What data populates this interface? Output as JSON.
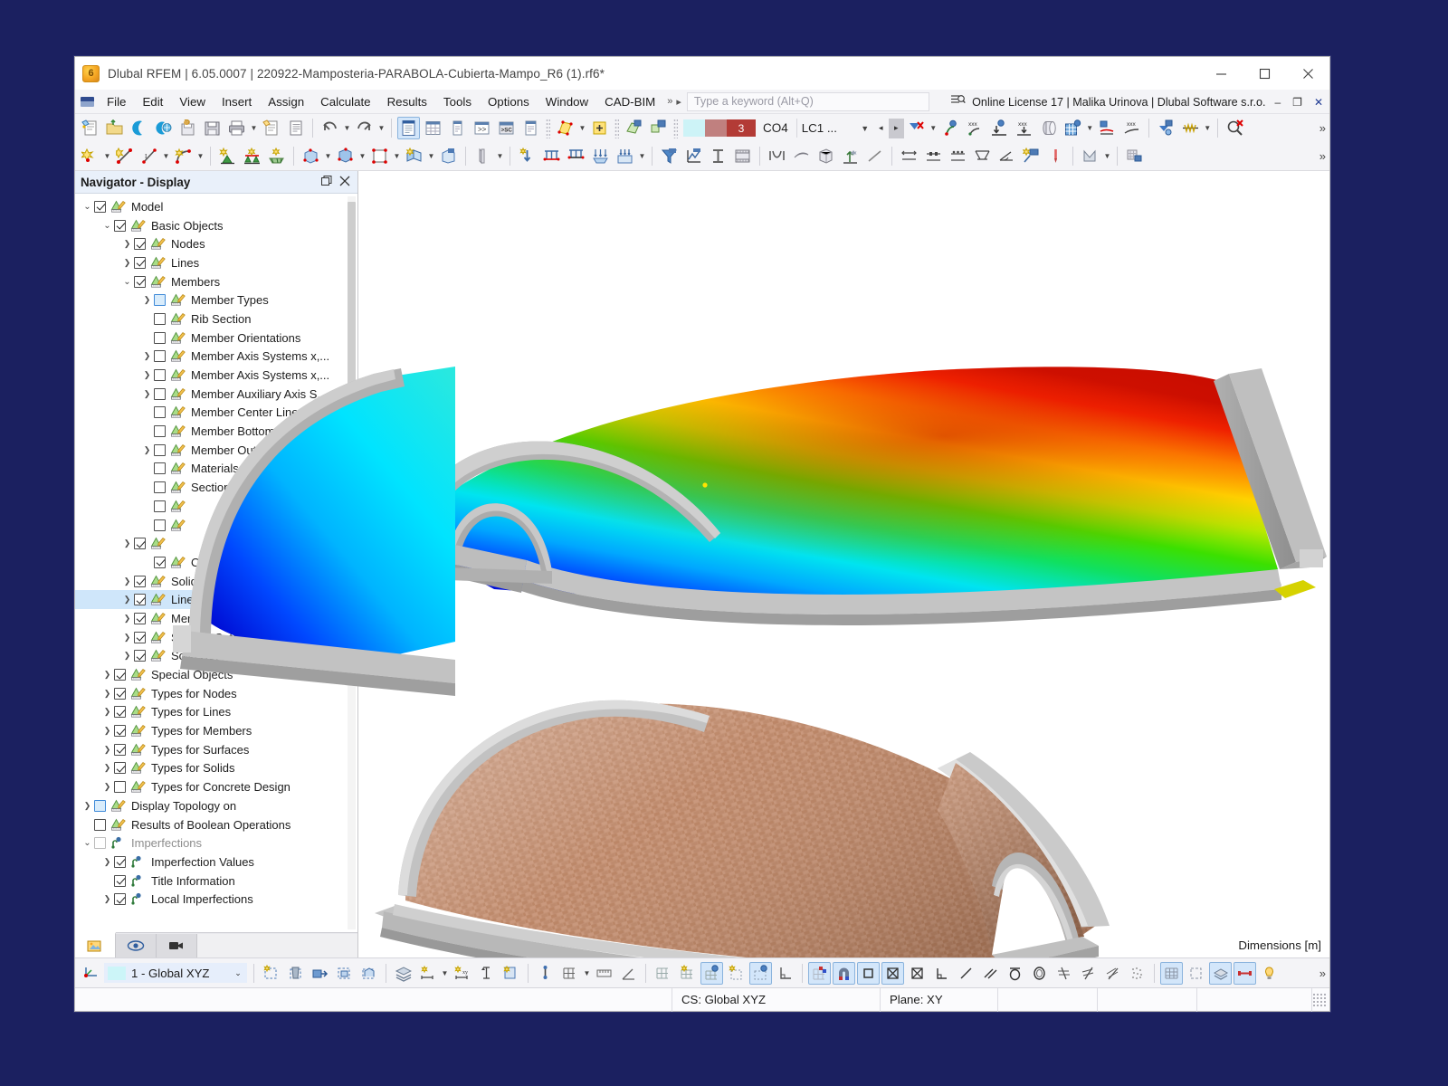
{
  "window": {
    "title": "Dlubal RFEM | 6.05.0007 | 220922-Mamposteria-PARABOLA-Cubierta-Mampo_R6 (1).rf6*",
    "app_icon": "6",
    "minimize": "minimize-icon",
    "maximize": "maximize-icon",
    "close": "close-icon"
  },
  "menu": {
    "items": [
      {
        "label": "File"
      },
      {
        "label": "Edit"
      },
      {
        "label": "View"
      },
      {
        "label": "Insert"
      },
      {
        "label": "Assign"
      },
      {
        "label": "Calculate"
      },
      {
        "label": "Results"
      },
      {
        "label": "Tools"
      },
      {
        "label": "Options"
      },
      {
        "label": "Window"
      },
      {
        "label": "CAD-BIM"
      }
    ],
    "overflow": "»",
    "play": "▸",
    "search_placeholder": "Type a keyword (Alt+Q)",
    "license": "Online License 17 | Malika Urinova | Dlubal Software s.r.o.",
    "license_minimize": "–",
    "license_restore": "❐",
    "license_close": "✕"
  },
  "toolbar": {
    "load_case": {
      "number": "3",
      "combination": "CO4",
      "load_case_label": "LC1 ...",
      "prev": "◂",
      "next": "▸"
    },
    "overflow": "»",
    "row1_icons": [
      "new-model-icon",
      "open-folder-icon",
      "connect-icon",
      "cloud-model-icon",
      "save-as-icon",
      "save-icon",
      "print-icon",
      "export-report-icon",
      "report-icon",
      "undo-icon",
      "redo-icon",
      "navigator-panel-icon",
      "table-panel-icon",
      "list-panel-icon",
      "console-icon",
      "script-icon",
      "data-panel-icon",
      "render-surface-icon",
      "add-object-icon",
      "select-visible-icon",
      "select-all-icon",
      "result-color-icon",
      "deformation-icon",
      "filter-results-icon",
      "node-result-icon",
      "value-xxx-icon",
      "support-reaction-icon",
      "support-values-icon",
      "section-view-icon",
      "grid-results-icon",
      "diagram-result-icon",
      "member-values-icon",
      "result-beam-icon",
      "result-diagram-icon",
      "search-cancel-icon"
    ],
    "row2_icons": [
      "node-icon",
      "line-icon",
      "line-dim-icon",
      "arc-icon",
      "support-node-icon",
      "support-line-icon",
      "support-surface-icon",
      "surface-icon",
      "solid-icon",
      "opening-icon",
      "member-icon",
      "block-icon",
      "thickness-icon",
      "load-icon",
      "nodal-load-icon",
      "line-load-icon",
      "member-load-icon",
      "surface-load-icon",
      "free-load-icon",
      "filter-icon",
      "diagram-icon",
      "cross-section-icon",
      "film-icon",
      "curve-icon",
      "wind-icon",
      "cube-icon",
      "imperfection-icon",
      "line-hinge-icon",
      "dimension-h-icon",
      "dimension-l-icon",
      "dimension-dots-icon",
      "dimension-angle-icon",
      "slope-icon",
      "annotation-icon",
      "pin-icon",
      "chart-icon",
      "grid-table-icon"
    ]
  },
  "navigator": {
    "title": "Navigator - Display",
    "undock": "undock-icon",
    "close": "close-icon",
    "tree": [
      {
        "label": "Model",
        "level": 0,
        "expand": "down",
        "check": "checked",
        "icon": "display-icon"
      },
      {
        "label": "Basic Objects",
        "level": 1,
        "expand": "down",
        "check": "checked",
        "icon": "display-icon"
      },
      {
        "label": "Nodes",
        "level": 2,
        "expand": "right",
        "check": "checked",
        "icon": "display-icon"
      },
      {
        "label": "Lines",
        "level": 2,
        "expand": "right",
        "check": "checked",
        "icon": "display-icon"
      },
      {
        "label": "Members",
        "level": 2,
        "expand": "down",
        "check": "checked",
        "icon": "display-icon"
      },
      {
        "label": "Member Types",
        "level": 3,
        "expand": "right",
        "check": "tri",
        "icon": "display-icon"
      },
      {
        "label": "Rib Section",
        "level": 3,
        "expand": "none",
        "check": "empty",
        "icon": "display-icon"
      },
      {
        "label": "Member Orientations",
        "level": 3,
        "expand": "none",
        "check": "empty",
        "icon": "display-icon"
      },
      {
        "label": "Member Axis Systems x,...",
        "level": 3,
        "expand": "right",
        "check": "empty",
        "icon": "display-icon"
      },
      {
        "label": "Member Axis Systems x,...",
        "level": 3,
        "expand": "right",
        "check": "empty",
        "icon": "display-icon"
      },
      {
        "label": "Member Auxiliary Axis S...",
        "level": 3,
        "expand": "right",
        "check": "empty",
        "icon": "display-icon"
      },
      {
        "label": "Member Center Lines",
        "level": 3,
        "expand": "none",
        "check": "empty",
        "icon": "display-icon"
      },
      {
        "label": "Member Bottom Fibers",
        "level": 3,
        "expand": "none",
        "check": "empty",
        "icon": "display-icon"
      },
      {
        "label": "Member Outlines",
        "level": 3,
        "expand": "right",
        "check": "empty",
        "icon": "display-icon"
      },
      {
        "label": "Materials",
        "level": 3,
        "expand": "none",
        "check": "empty",
        "icon": "display-icon"
      },
      {
        "label": "Sections",
        "level": 3,
        "expand": "none",
        "check": "empty",
        "icon": "display-icon"
      },
      {
        "label": "",
        "level": 3,
        "expand": "none",
        "check": "empty",
        "icon": "display-icon"
      },
      {
        "label": "",
        "level": 3,
        "expand": "none",
        "check": "empty",
        "icon": "display-icon"
      },
      {
        "label": "",
        "level": 2,
        "expand": "right",
        "check": "checked",
        "icon": "display-icon"
      },
      {
        "label": "Openings",
        "level": 3,
        "expand": "none",
        "check": "checked",
        "icon": "display-icon"
      },
      {
        "label": "Solids",
        "level": 2,
        "expand": "right",
        "check": "checked",
        "icon": "display-icon"
      },
      {
        "label": "Line Sets",
        "level": 2,
        "expand": "right",
        "check": "checked",
        "icon": "display-icon",
        "selected": true
      },
      {
        "label": "Member Sets",
        "level": 2,
        "expand": "right",
        "check": "checked",
        "icon": "display-icon"
      },
      {
        "label": "Surface Sets",
        "level": 2,
        "expand": "right",
        "check": "checked",
        "icon": "display-icon"
      },
      {
        "label": "Solid Sets",
        "level": 2,
        "expand": "right",
        "check": "checked",
        "icon": "display-icon"
      },
      {
        "label": "Special Objects",
        "level": 1,
        "expand": "right",
        "check": "checked",
        "icon": "display-icon"
      },
      {
        "label": "Types for Nodes",
        "level": 1,
        "expand": "right",
        "check": "checked",
        "icon": "display-icon"
      },
      {
        "label": "Types for Lines",
        "level": 1,
        "expand": "right",
        "check": "checked",
        "icon": "display-icon"
      },
      {
        "label": "Types for Members",
        "level": 1,
        "expand": "right",
        "check": "checked",
        "icon": "display-icon"
      },
      {
        "label": "Types for Surfaces",
        "level": 1,
        "expand": "right",
        "check": "checked",
        "icon": "display-icon"
      },
      {
        "label": "Types for Solids",
        "level": 1,
        "expand": "right",
        "check": "checked",
        "icon": "display-icon"
      },
      {
        "label": "Types for Concrete Design",
        "level": 1,
        "expand": "right",
        "check": "empty",
        "icon": "display-icon"
      },
      {
        "label": "Display Topology on",
        "level": 0,
        "expand": "right",
        "check": "tri",
        "icon": "display-icon"
      },
      {
        "label": "Results of Boolean Operations",
        "level": 0,
        "expand": "none",
        "check": "empty",
        "icon": "display-icon"
      },
      {
        "label": "Imperfections",
        "level": 0,
        "expand": "down",
        "check": "ghost",
        "icon": "imperfection-icon",
        "dim": true
      },
      {
        "label": "Imperfection Values",
        "level": 1,
        "expand": "right",
        "check": "checked",
        "icon": "imperfection-icon"
      },
      {
        "label": "Title Information",
        "level": 1,
        "expand": "none",
        "check": "checked",
        "icon": "imperfection-icon"
      },
      {
        "label": "Local Imperfections",
        "level": 1,
        "expand": "right",
        "check": "checked",
        "icon": "imperfection-icon"
      }
    ],
    "tabs": [
      {
        "name": "project-navigator-tab",
        "icon": "project-image-icon",
        "active": true
      },
      {
        "name": "display-navigator-tab",
        "icon": "eye-icon",
        "active": false
      },
      {
        "name": "views-navigator-tab",
        "icon": "video-camera-icon",
        "active": false
      }
    ]
  },
  "viewport": {
    "dimensions_label": "Dimensions [m]",
    "models": [
      {
        "name": "deformation-result-model",
        "description": "Parabolic vaulted masonry roof with rainbow result color map"
      },
      {
        "name": "masonry-render-model",
        "description": "Parabolic vaulted masonry roof rendered with brick texture"
      }
    ],
    "colors": {
      "result_max": "#c80000",
      "result_high": "#ff2b00",
      "result_mid_high": "#ffd100",
      "result_mid": "#00dd22",
      "result_low": "#00e0ff",
      "result_min": "#0000d0",
      "brick": "#c08b6d",
      "concrete": "#a9a9a9",
      "background": "#ffffff"
    }
  },
  "bottom_toolbar": {
    "coordinate_system": "1 - Global XYZ",
    "cs_caret": "⌄",
    "overflow": "»",
    "icons": [
      "new-view-icon",
      "delete-view-icon",
      "apply-view-icon",
      "clip-view-icon",
      "section-view-icon",
      "layers-icon",
      "dim-x-icon",
      "dim-xy-icon",
      "visibility-icon",
      "copy-visibility-icon",
      "point-snap-icon",
      "grid-snap-icon",
      "ruler-icon",
      "angle-icon",
      "grid-display-icon",
      "grid-work-icon",
      "grid-active-icon",
      "grid-guide-icon",
      "grid-plane-icon",
      "ortho-icon",
      "object-snap-icon",
      "magnet-snap-icon",
      "rect-snap-icon",
      "center-snap-icon",
      "bbox-snap-icon",
      "perp-snap-icon",
      "line-snap-icon",
      "parallel-snap-icon",
      "tangent-snap-icon",
      "ellipse-snap-icon",
      "intersect-1-icon",
      "intersect-2-icon",
      "intersect-3-icon",
      "point-cloud-icon",
      "grid-toggle-icon",
      "frame-toggle-icon",
      "render-toggle-icon",
      "beam-toggle-icon",
      "light-toggle-icon"
    ]
  },
  "statusbar": {
    "cs": "CS: Global XYZ",
    "plane": "Plane: XY"
  }
}
